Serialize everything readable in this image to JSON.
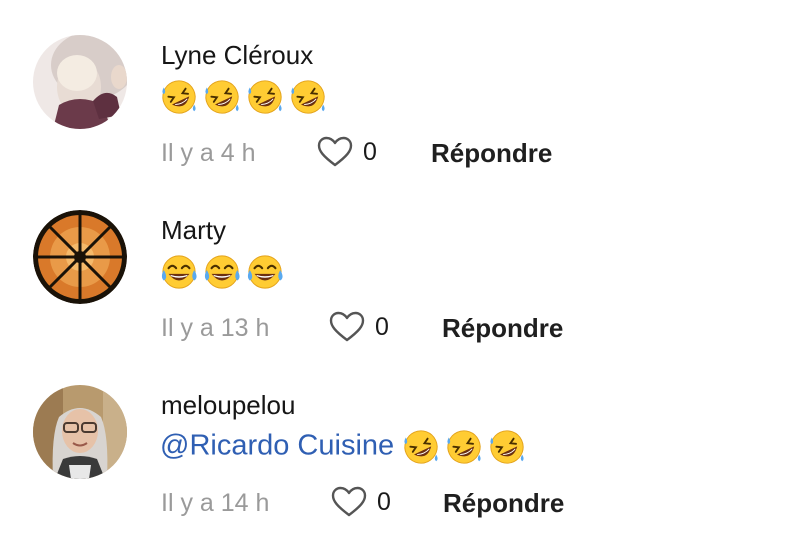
{
  "comments": [
    {
      "author": "Lyne Cléroux",
      "mention": "",
      "emojis": [
        "rofl-emoji",
        "rofl-emoji",
        "rofl-emoji",
        "rofl-emoji"
      ],
      "time": "Il y a 4 h",
      "likes": "0",
      "reply_label": "Répondre"
    },
    {
      "author": "Marty",
      "mention": "",
      "emojis": [
        "tears-of-joy-emoji",
        "tears-of-joy-emoji",
        "tears-of-joy-emoji"
      ],
      "time": "Il y a 13 h",
      "likes": "0",
      "reply_label": "Répondre"
    },
    {
      "author": "meloupelou",
      "mention": "@Ricardo Cuisine",
      "emojis": [
        "rofl-emoji",
        "rofl-emoji",
        "rofl-emoji"
      ],
      "time": "Il y a 14 h",
      "likes": "0",
      "reply_label": "Répondre"
    }
  ],
  "icons": {
    "like": "heart-outline-icon"
  },
  "colors": {
    "mention": "#2f5fb3",
    "timestamp": "#9a9a9a"
  }
}
